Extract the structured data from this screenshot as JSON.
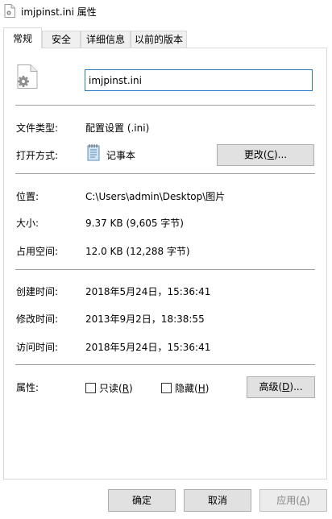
{
  "window": {
    "title": "imjpinst.ini 属性"
  },
  "tabs": [
    {
      "label": "常规",
      "active": true
    },
    {
      "label": "安全",
      "active": false
    },
    {
      "label": "详细信息",
      "active": false
    },
    {
      "label": "以前的版本",
      "active": false
    }
  ],
  "general": {
    "file_name": "imjpinst.ini",
    "file_type_label": "文件类型:",
    "file_type_value": "配置设置 (.ini)",
    "open_with_label": "打开方式:",
    "open_with_value": "记事本",
    "change_button": {
      "text": "更改(",
      "key": "C",
      "suffix": ")..."
    },
    "location_label": "位置:",
    "location_value": "C:\\Users\\admin\\Desktop\\图片",
    "size_label": "大小:",
    "size_value": "9.37 KB (9,605 字节)",
    "size_on_disk_label": "占用空间:",
    "size_on_disk_value": "12.0 KB (12,288 字节)",
    "created_label": "创建时间:",
    "created_value": "2018年5月24日，15:36:41",
    "modified_label": "修改时间:",
    "modified_value": "2013年9月2日，18:38:55",
    "accessed_label": "访问时间:",
    "accessed_value": "2018年5月24日，15:36:41",
    "attributes_label": "属性:",
    "readonly": {
      "text": "只读(",
      "key": "R",
      "suffix": ")",
      "checked": false
    },
    "hidden": {
      "text": "隐藏(",
      "key": "H",
      "suffix": ")",
      "checked": false
    },
    "advanced_button": {
      "text": "高级(",
      "key": "D",
      "suffix": ")..."
    }
  },
  "footer": {
    "ok": "确定",
    "cancel": "取消",
    "apply": {
      "text": "应用(",
      "key": "A",
      "suffix": ")",
      "enabled": false
    }
  },
  "icons": {
    "title": "ini-file-icon",
    "file": "config-file-gear-icon",
    "open_with": "notepad-icon"
  }
}
